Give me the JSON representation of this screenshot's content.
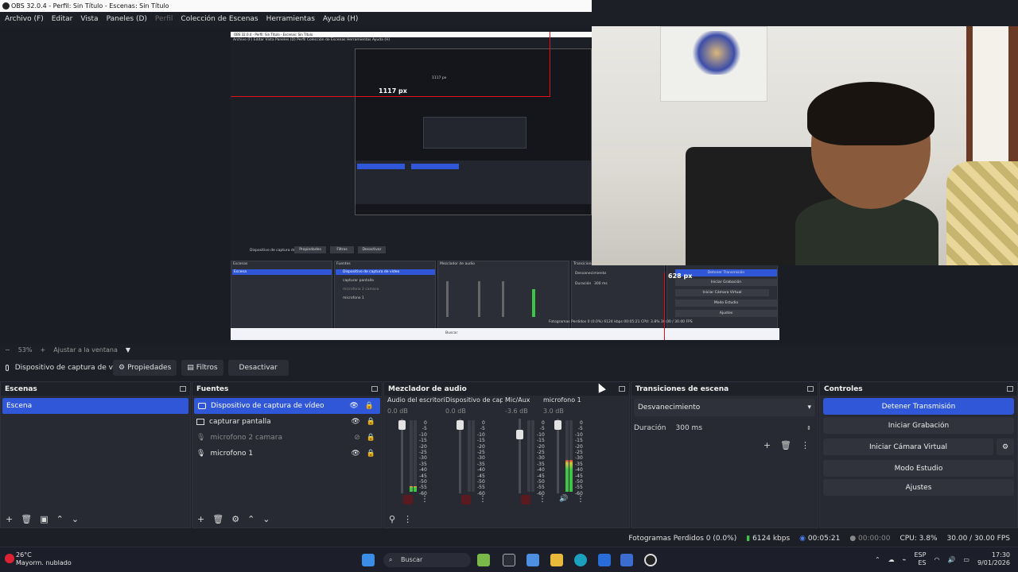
{
  "window": {
    "title": "OBS 32.0.4 - Perfil: Sin Título - Escenas: Sin Título"
  },
  "menu": [
    "Archivo (F)",
    "Editar",
    "Vista",
    "Paneles (D)",
    "Perfil",
    "Colección de Escenas",
    "Herramientas",
    "Ayuda (H)"
  ],
  "preview": {
    "marker_width": "1117 px",
    "marker_inner": "1117 px",
    "marker_height": "628 px",
    "inner_title": "OBS 32.0.4 - Perfil: Sin Título - Escenas: Sin Título",
    "inner_menu": "Archivo (F)   Editar   Vista   Paneles (D)   Perfil   Colección de Escenas   Herramientas   Ayuda (H)",
    "inner_scene": "Escena",
    "inner_source1": "Dispositivo de captura de vídeo",
    "inner_source2": "capturar pantalla",
    "inner_source3": "microfono 2 camara",
    "inner_source4": "microfono 1",
    "inner_props": "Propiedades",
    "inner_filters": "Filtros",
    "inner_deactivate": "Desactivar",
    "inner_src_label": "Dispositivo de captura de v",
    "inner_h_scenes": "Escenas",
    "inner_h_sources": "Fuentes",
    "inner_h_mixer": "Mezclador de audio",
    "inner_h_trans": "Transiciones de escena",
    "inner_h_ctrl": "Controles",
    "inner_fade": "Desvanecimiento",
    "inner_dur": "Duración",
    "inner_dur_val": "300 ms",
    "inner_btn1": "Detener Transmisión",
    "inner_btn2": "Iniciar Grabación",
    "inner_btn3": "Iniciar Cámara Virtual",
    "inner_btn4": "Modo Estudio",
    "inner_btn5": "Ajustes",
    "inner_status": "Fotogramas Perdidos 0 (0.0%)   6124 kbps   00:05:21   CPU: 3.8%   30.00 / 30.00 FPS",
    "inner_search": "Buscar"
  },
  "zoom": {
    "minus": "−",
    "level": "53%",
    "plus": "+",
    "fit": "Ajustar a la ventana",
    "caret": "▼"
  },
  "toolbar": {
    "source_label": "Dispositivo de captura de v",
    "properties": "Propiedades",
    "filters": "Filtros",
    "deactivate": "Desactivar"
  },
  "scenes": {
    "title": "Escenas",
    "items": [
      "Escena"
    ]
  },
  "sources": {
    "title": "Fuentes",
    "items": [
      {
        "name": "Dispositivo de captura de vídeo",
        "icon": "camera-icon"
      },
      {
        "name": "capturar pantalla",
        "icon": "monitor-icon"
      },
      {
        "name": "microfono 2 camara",
        "icon": "microphone-icon"
      },
      {
        "name": "microfono 1",
        "icon": "microphone-icon"
      }
    ]
  },
  "mixer": {
    "title": "Mezclador de audio",
    "channels": [
      {
        "name": "Audio del escritorio",
        "db": "0.0 dB",
        "level": 0.08
      },
      {
        "name": "Dispositivo de captura",
        "db": "0.0 dB",
        "level": 0.0
      },
      {
        "name": "Mic/Aux",
        "db": "-3.6 dB",
        "level": 0.0
      },
      {
        "name": "microfono 1",
        "db": "3.0 dB",
        "level": 0.45
      }
    ],
    "scale": [
      "0",
      "-5",
      "-10",
      "-15",
      "-20",
      "-25",
      "-30",
      "-35",
      "-40",
      "-45",
      "-50",
      "-55",
      "-60"
    ]
  },
  "transitions": {
    "title": "Transiciones de escena",
    "type": "Desvanecimiento",
    "duration_label": "Duración",
    "duration_value": "300 ms"
  },
  "controls": {
    "title": "Controles",
    "stop_stream": "Detener Transmisión",
    "start_rec": "Iniciar Grabación",
    "start_vcam": "Iniciar Cámara Virtual",
    "studio": "Modo Estudio",
    "settings": "Ajustes"
  },
  "status": {
    "dropped": "Fotogramas Perdidos 0 (0.0%)",
    "bitrate": "6124 kbps",
    "stream_time": "00:05:21",
    "rec_time": "00:00:00",
    "cpu": "CPU: 3.8%",
    "fps": "30.00 / 30.00 FPS"
  },
  "taskbar": {
    "temp": "26°C",
    "weather": "Mayorm. nublado",
    "search": "Buscar",
    "lang": "ESP",
    "lang2": "ES",
    "time": "17:30",
    "date": "9/01/2026"
  }
}
